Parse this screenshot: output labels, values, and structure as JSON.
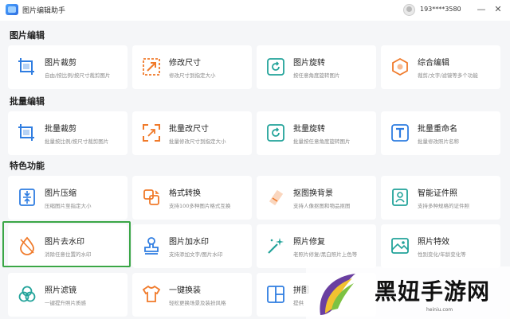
{
  "app": {
    "title": "图片编辑助手",
    "user": "193****3580"
  },
  "window": {
    "minimize": "—",
    "close": "✕"
  },
  "sections": {
    "image_edit": "图片编辑",
    "batch_edit": "批量编辑",
    "features": "特色功能"
  },
  "cards": {
    "crop": {
      "title": "图片裁剪",
      "desc": "自由/按比例/按尺寸裁剪图片",
      "icon": "crop-icon"
    },
    "resize": {
      "title": "修改尺寸",
      "desc": "修改尺寸到指定大小",
      "icon": "resize-icon"
    },
    "rotate": {
      "title": "图片旋转",
      "desc": "按任意角度旋转图片",
      "icon": "rotate-icon"
    },
    "composite": {
      "title": "综合编辑",
      "desc": "裁剪/文字/滤镜等多个功能",
      "icon": "edit-icon"
    },
    "batch_crop": {
      "title": "批量裁剪",
      "desc": "批量按比例/按尺寸裁剪图片",
      "icon": "crop-icon"
    },
    "batch_resize": {
      "title": "批量改尺寸",
      "desc": "批量修改尺寸到指定大小",
      "icon": "resize-icon"
    },
    "batch_rotate": {
      "title": "批量旋转",
      "desc": "批量按任意角度旋转图片",
      "icon": "rotate-icon"
    },
    "batch_rename": {
      "title": "批量重命名",
      "desc": "批量修改照片名称",
      "icon": "text-icon"
    },
    "compress": {
      "title": "图片压缩",
      "desc": "压缩图片至指定大小",
      "icon": "compress-icon"
    },
    "convert": {
      "title": "格式转换",
      "desc": "支持100多种图片格式互换",
      "icon": "convert-icon"
    },
    "cutout": {
      "title": "抠图换背景",
      "desc": "支持人像抠图和物品抠图",
      "icon": "eraser-icon"
    },
    "id_photo": {
      "title": "智能证件照",
      "desc": "支持多种规格的证件照",
      "icon": "id-photo-icon"
    },
    "remove_wm": {
      "title": "图片去水印",
      "desc": "消除任意位置的水印",
      "icon": "water-drop-icon"
    },
    "add_wm": {
      "title": "图片加水印",
      "desc": "支持添加文字/图片水印",
      "icon": "stamp-icon"
    },
    "restore": {
      "title": "照片修复",
      "desc": "老照片修复/黑白照片上色等",
      "icon": "magic-wand-icon"
    },
    "effects": {
      "title": "照片特效",
      "desc": "性别变化/年龄变化等",
      "icon": "effects-icon"
    },
    "filter": {
      "title": "照片滤镜",
      "desc": "一键提升照片质感",
      "icon": "filter-icon"
    },
    "outfit": {
      "title": "一键换装",
      "desc": "轻松更换场景及装扮风格",
      "icon": "shirt-icon"
    },
    "collage": {
      "title": "拼图",
      "desc": "提供",
      "icon": "grid-icon"
    }
  },
  "watermark": {
    "text": "黑妞手游网",
    "url": "heiniu.com"
  },
  "colors": {
    "blue": "#2f7de1",
    "orange": "#f07a2a",
    "teal": "#22a39a",
    "highlight": "#3aa646"
  }
}
